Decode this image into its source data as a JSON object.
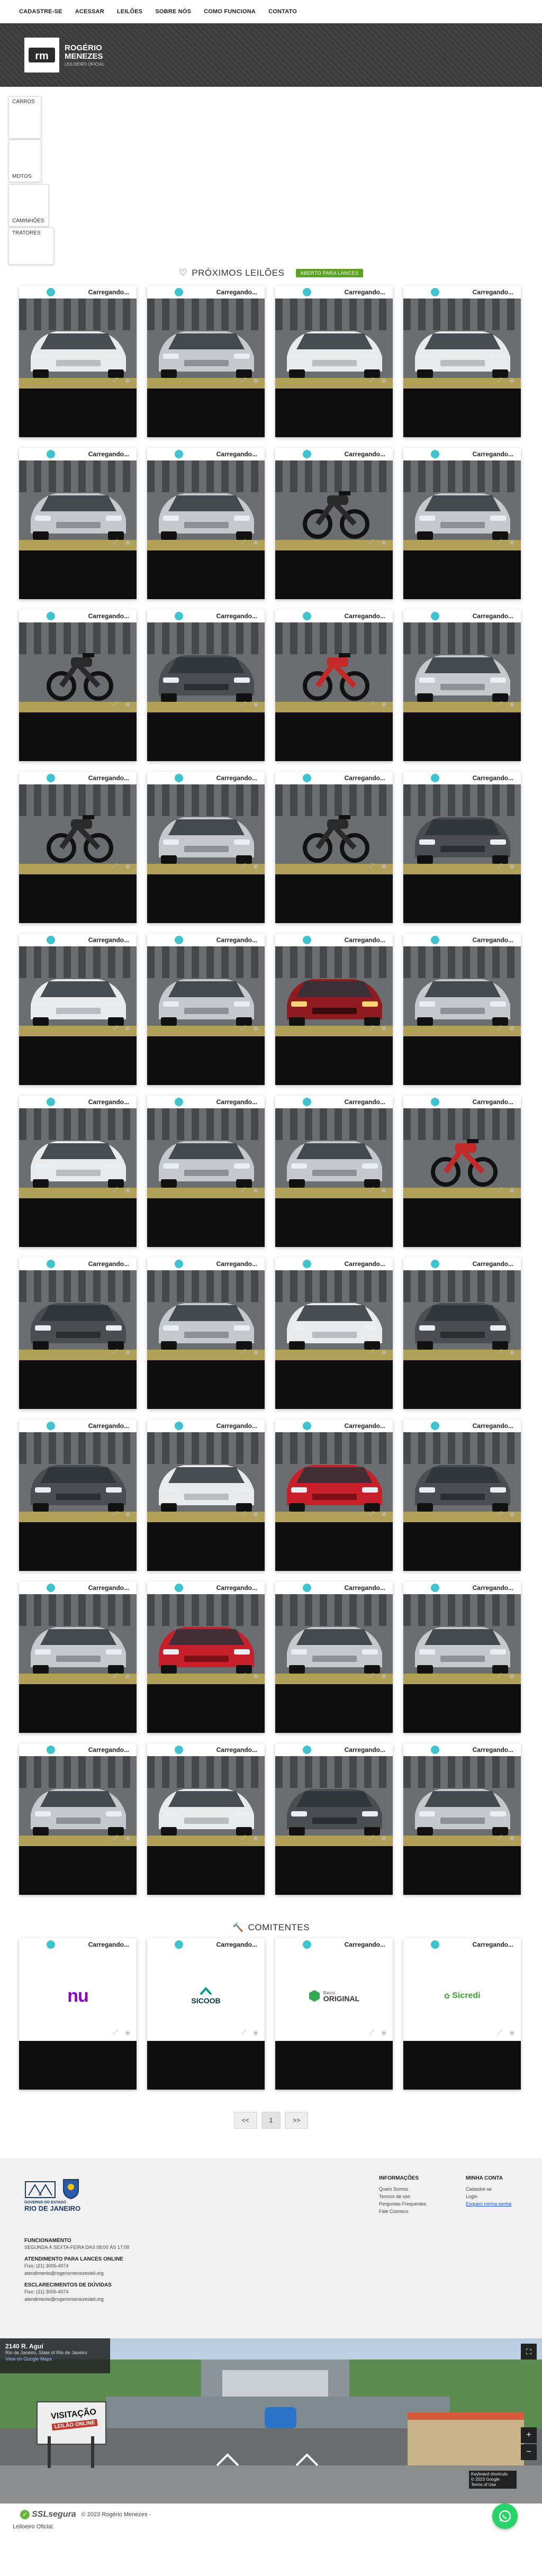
{
  "nav": [
    "CADASTRE-SE",
    "ACESSAR",
    "LEILÕES",
    "SOBRE NÓS",
    "COMO FUNCIONA",
    "CONTATO"
  ],
  "brand": {
    "line1": "ROGÉRIO",
    "line2": "MENEZES",
    "line3": "LEILOEIRO OFICIAL",
    "monogram": "rm"
  },
  "categories": [
    "CARROS",
    "MOTOS",
    "CAMINHÕES",
    "TRATORES"
  ],
  "auctions": {
    "title": "PRÓXIMOS LEILÕES",
    "badge": "ABERTO PARA LANCES",
    "loading": "Carregando..."
  },
  "vehicles": [
    "white",
    "silver",
    "white",
    "white",
    "silver",
    "silver",
    "moto",
    "silver",
    "moto",
    "dark",
    "moto-red",
    "silver",
    "moto",
    "silver",
    "moto",
    "dark",
    "white",
    "silver",
    "red-light",
    "silver",
    "white",
    "silver",
    "silver",
    "moto-red",
    "dark",
    "silver",
    "white",
    "dark",
    "dark",
    "white",
    "red",
    "dark",
    "silver",
    "red",
    "silver",
    "silver",
    "silver",
    "white",
    "dark",
    "silver"
  ],
  "consignors": {
    "title": "COMITENTES",
    "logos": [
      "nu",
      "SICOOB",
      "ORIGINAL",
      "Sicredi"
    ],
    "banco": "Banco",
    "colors": {
      "nu": "#8a05be",
      "sicoob": "#00a091",
      "original": "#33a852",
      "sicredi": "#3fa535"
    }
  },
  "pagination": [
    "<<",
    "1",
    ">>"
  ],
  "footer": {
    "state_line1": "GOVERNO DO ESTADO",
    "state_line2": "RIO DE JANEIRO",
    "hours_title": "FUNCIONAMENTO",
    "hours": "SEGUNDA À SEXTA-FEIRA DAS 08:00 ÀS 17:00",
    "online_title": "ATENDIMENTO PARA LANCES ONLINE",
    "online_phone": "Fixo: (21) 3005-4074",
    "online_email": "atendimento@rogeriomenezesleil.org",
    "doubts_title": "ESCLARECIMENTOS DE DÚVIDAS",
    "doubts_phone": "Fixo: (21) 3005-4074",
    "doubts_email": "atendimento@rogeriomenezesleil.org",
    "info_title": "INFORMAÇÕES",
    "info_links": [
      "Quem Somos",
      "Termos de uso",
      "Perguntas Frequentes",
      "Fale Conosco"
    ],
    "account_title": "MINHA CONTA",
    "account_links": [
      "Cadastre-se",
      "Login",
      "Esqueci minha senha"
    ]
  },
  "street": {
    "address": "2140 R. Aguí",
    "city": "Rio de Janeiro, State of Rio de Janeiro",
    "link": "View on Google Maps",
    "sign1": "VISITAÇÃO",
    "sign2": "LEILÃO ONLINE",
    "credit1": "Keyboard shortcuts",
    "credit2": "© 2023 Google",
    "credit3": "Terms of Use"
  },
  "bottom": {
    "ssl": "SSLsegura",
    "copy": "© 2023 Rogério Menezes -",
    "copy2": "Leiloeiro Oficial."
  }
}
